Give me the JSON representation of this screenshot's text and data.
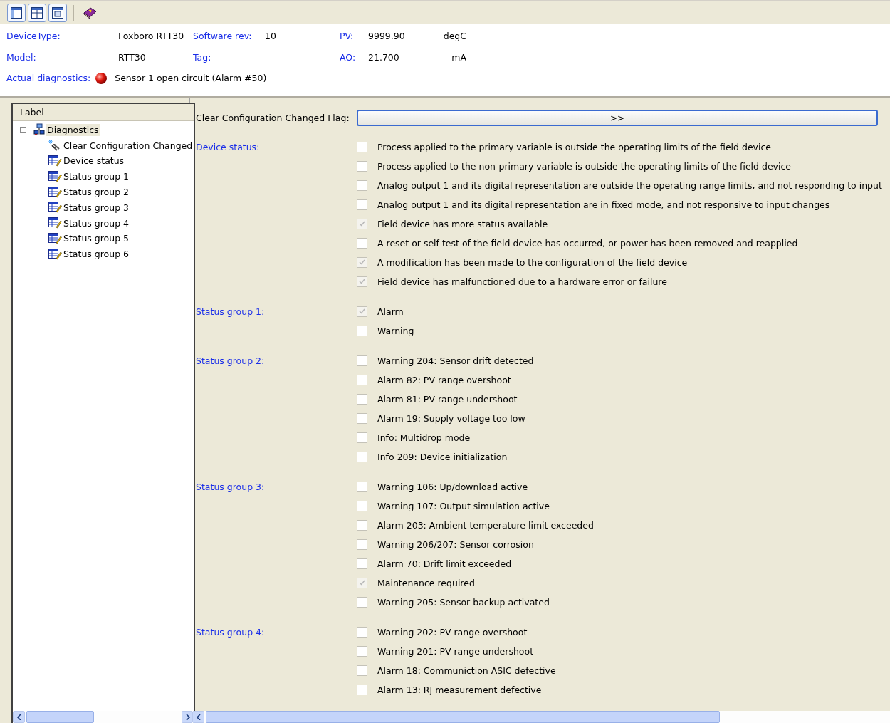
{
  "header": {
    "rows": [
      [
        {
          "label": "DeviceType:",
          "value": "Foxboro RTT30"
        },
        {
          "label": "Software rev:",
          "value": "10"
        },
        {
          "label": "PV:",
          "value": "9999.90",
          "unit": "degC"
        }
      ],
      [
        {
          "label": "Model:",
          "value": "RTT30"
        },
        {
          "label": "Tag:"
        },
        {
          "label": "AO:",
          "value": "21.700",
          "unit": "mA"
        }
      ]
    ],
    "diagnostics": {
      "label": "Actual diagnostics:",
      "value": "Sensor 1 open circuit (Alarm #50)"
    }
  },
  "tree": {
    "column": "Label",
    "root": {
      "label": "Diagnostics",
      "expanded": true,
      "selected": true,
      "children": [
        {
          "label": "Clear Configuration Changed",
          "kind": "action"
        },
        {
          "label": "Device status",
          "kind": "table"
        },
        {
          "label": "Status group 1",
          "kind": "table"
        },
        {
          "label": "Status group 2",
          "kind": "table"
        },
        {
          "label": "Status group 3",
          "kind": "table"
        },
        {
          "label": "Status group 4",
          "kind": "table"
        },
        {
          "label": "Status group 5",
          "kind": "table"
        },
        {
          "label": "Status group 6",
          "kind": "table"
        }
      ]
    }
  },
  "action": {
    "label": "Clear Configuration Changed Flag:",
    "button": ">>"
  },
  "groups": [
    {
      "label": "Device status:",
      "items": [
        {
          "text": "Process applied to the primary variable is outside the operating limits of the field device",
          "checked": false
        },
        {
          "text": "Process applied to the non-primary variable is outside the operating limits of the field device",
          "checked": false
        },
        {
          "text": "Analog output 1 and its digital representation are outside the operating range limits, and not responding to input",
          "checked": false
        },
        {
          "text": "Analog output 1 and its digital representation are in fixed mode, and not responsive to input changes",
          "checked": false
        },
        {
          "text": "Field device has more status available",
          "checked": true
        },
        {
          "text": "A reset or self test of the field device has occurred, or power has been removed and reapplied",
          "checked": false
        },
        {
          "text": "A modification has been made to the configuration of the field device",
          "checked": true
        },
        {
          "text": "Field device has malfunctioned due to a hardware error or failure",
          "checked": true
        }
      ]
    },
    {
      "label": "Status group 1:",
      "items": [
        {
          "text": "Alarm",
          "checked": true
        },
        {
          "text": "Warning",
          "checked": false
        }
      ]
    },
    {
      "label": "Status group 2:",
      "items": [
        {
          "text": "Warning 204: Sensor drift detected",
          "checked": false
        },
        {
          "text": "Alarm 82: PV range overshoot",
          "checked": false
        },
        {
          "text": "Alarm 81: PV range undershoot",
          "checked": false
        },
        {
          "text": "Alarm 19: Supply voltage too low",
          "checked": false
        },
        {
          "text": "Info: Multidrop mode",
          "checked": false
        },
        {
          "text": "Info 209: Device initialization",
          "checked": false
        }
      ]
    },
    {
      "label": "Status group 3:",
      "items": [
        {
          "text": "Warning 106: Up/download active",
          "checked": false
        },
        {
          "text": "Warning 107: Output simulation active",
          "checked": false
        },
        {
          "text": "Alarm 203: Ambient temperature limit exceeded",
          "checked": false
        },
        {
          "text": "Warning 206/207: Sensor corrosion",
          "checked": false
        },
        {
          "text": "Alarm 70: Drift limit exceeded",
          "checked": false
        },
        {
          "text": "Maintenance required",
          "checked": true
        },
        {
          "text": "Warning 205: Sensor backup activated",
          "checked": false
        }
      ]
    },
    {
      "label": "Status group 4:",
      "items": [
        {
          "text": "Warning 202: PV range overshoot",
          "checked": false
        },
        {
          "text": "Warning 201: PV range undershoot",
          "checked": false
        },
        {
          "text": "Alarm 18: Communiction ASIC defective",
          "checked": false
        },
        {
          "text": "Alarm 13: RJ measurement defective",
          "checked": false
        }
      ]
    }
  ]
}
